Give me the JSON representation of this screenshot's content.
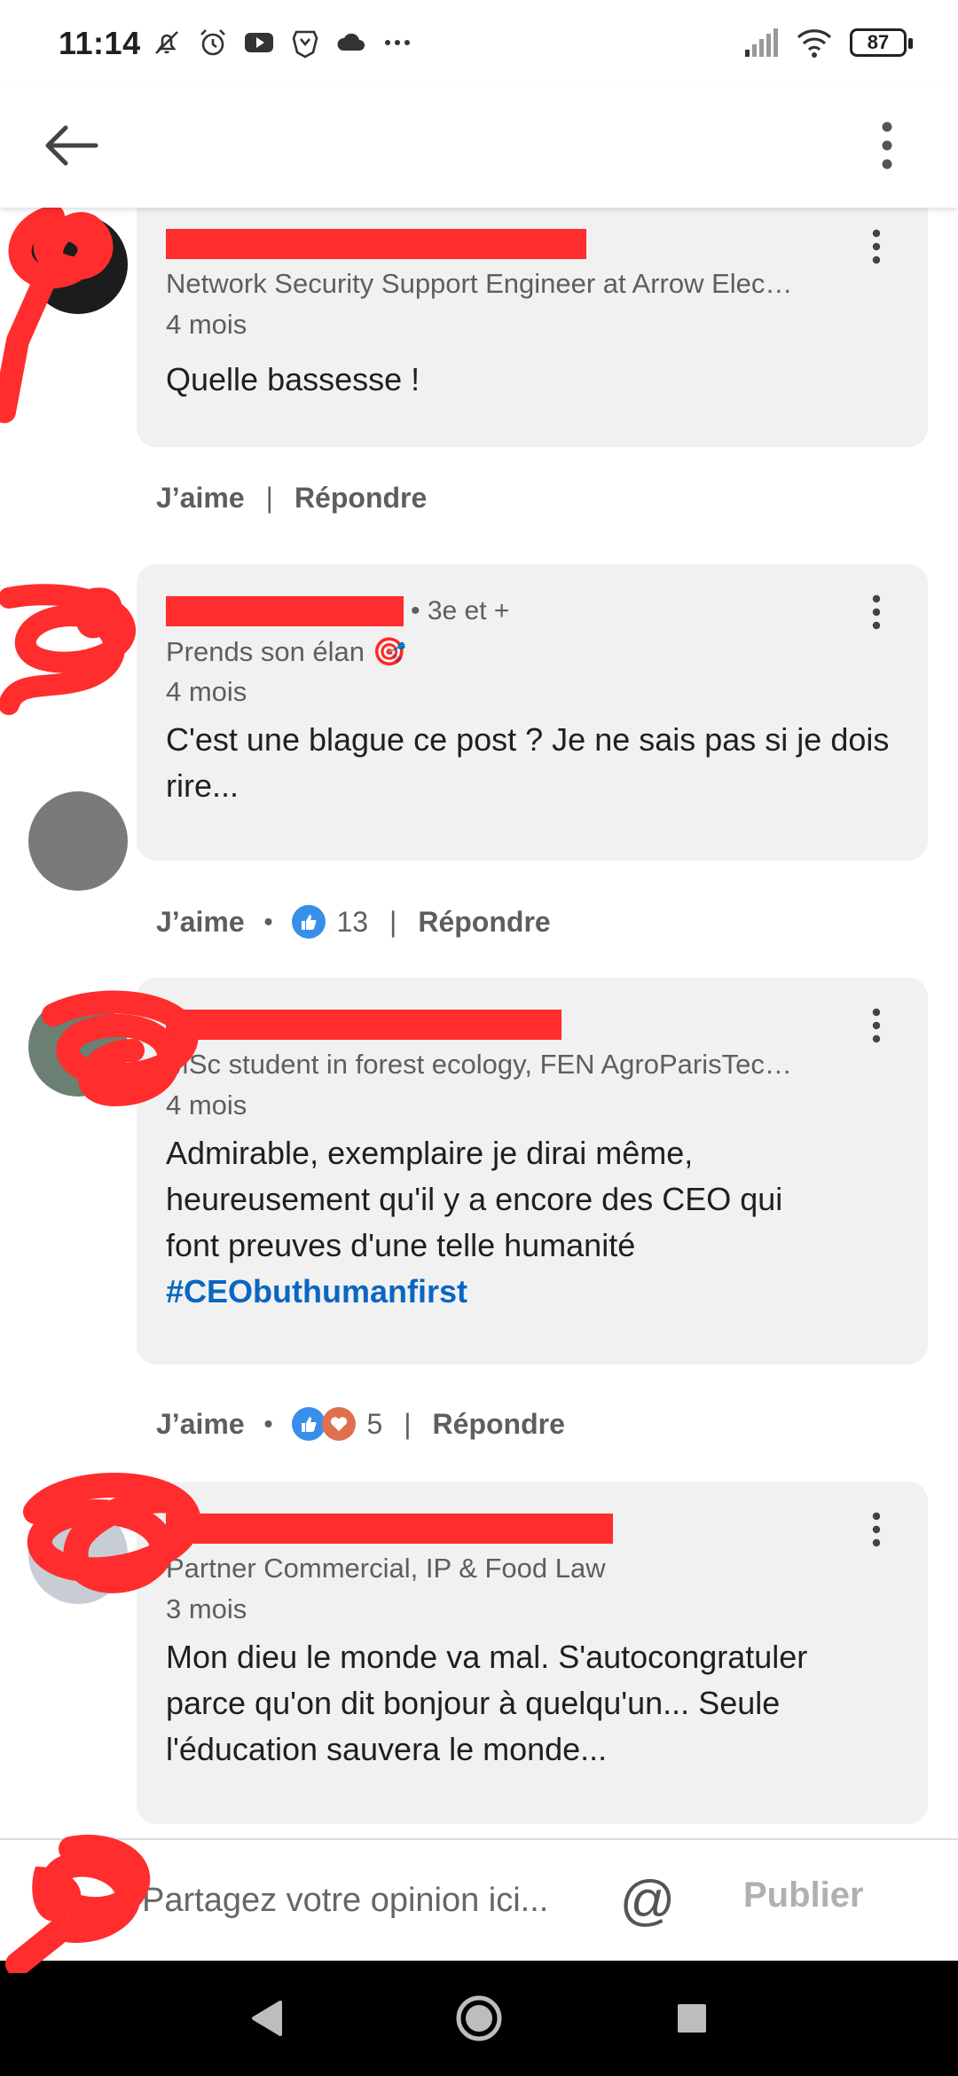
{
  "status_bar": {
    "time": "11:14",
    "battery": "87",
    "left_icons": [
      "mute-icon",
      "alarm-icon",
      "youtube-icon",
      "brave-icon",
      "cloud-icon",
      "more-dots-icon"
    ],
    "right_icons": [
      "signal-icon",
      "wifi-icon",
      "battery-icon"
    ]
  },
  "app_bar": {
    "back_icon": "arrow-left-icon",
    "menu_icon": "vertical-dots-icon"
  },
  "colors": {
    "accent": "#0a66c2",
    "redaction": "#ff2d2d",
    "bubble": "#f1f1f1",
    "like": "#378fe9",
    "love": "#df704d"
  },
  "comments": [
    {
      "headline": "Network Security Support Engineer at Arrow Elec…",
      "time": "4 mois",
      "text": "Quelle bassesse !",
      "like": "J’aime",
      "reply": "Répondre"
    },
    {
      "degree": "• 3e et +",
      "headline": "Prends son élan 🎯",
      "time": "4 mois",
      "text": "C'est une blague ce post ? Je ne sais pas si je dois rire...",
      "like": "J’aime",
      "reactions": "13",
      "reply": "Répondre"
    },
    {
      "headline": "MSc student in forest ecology, FEN AgroParisTec…",
      "time": "4 mois",
      "text": "Admirable, exemplaire je dirai même, heureusement qu'il y a encore des CEO qui font preuves d'une telle humanité",
      "hashtag": "#CEObuthumanfirst",
      "like": "J’aime",
      "reactions": "5",
      "reply": "Répondre"
    },
    {
      "headline": "Partner Commercial, IP & Food Law",
      "time": "3 mois",
      "text": "Mon dieu le monde va mal. S'autocongratuler parce qu'on dit bonjour à quelqu'un... Seule l'éducation sauvera le monde..."
    }
  ],
  "composer": {
    "placeholder": "Partagez votre opinion ici...",
    "mention": "@",
    "publish": "Publier"
  },
  "nav_bar": {
    "icons": [
      "back-triangle-icon",
      "home-circle-icon",
      "recents-square-icon"
    ]
  }
}
